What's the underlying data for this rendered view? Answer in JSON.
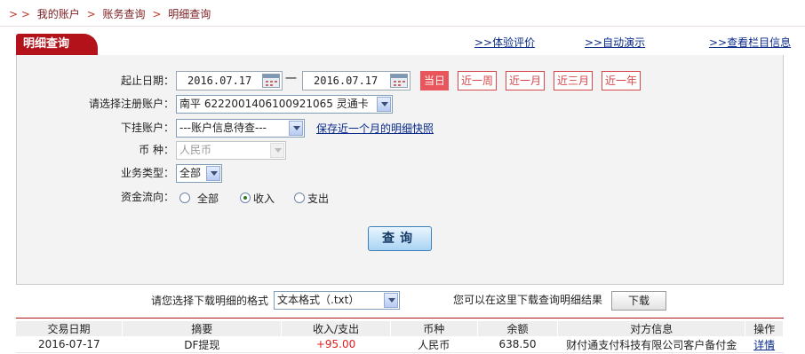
{
  "breadcrumb": {
    "arrows": ">  >",
    "items": [
      "我的账户",
      "账务查询",
      "明细查询"
    ]
  },
  "panel": {
    "title": "明细查询",
    "links": [
      ">>体验评价",
      ">>自动演示",
      ">>查看栏目信息"
    ]
  },
  "form": {
    "date_label": "起止日期：",
    "start_date": "2016.07.17",
    "dash": "一",
    "end_date": "2016.07.17",
    "quick_ranges": [
      "当日",
      "近一周",
      "近一月",
      "近三月",
      "近一年"
    ],
    "account_label": "请选择注册账户：",
    "account_value": "南平  6222001406100921065 灵通卡",
    "sub_label": "下挂账户：",
    "sub_value": "---账户信息待查---",
    "save_link": "保存近一个月的明细快照",
    "currency_label": "币      种：",
    "currency_value": "人民币",
    "biz_label": "业务类型：",
    "biz_value": "全部",
    "flow_label": "资金流向：",
    "flow_options": [
      "全部",
      "收入",
      "支出"
    ],
    "flow_selected": "收入",
    "query_button": "查询"
  },
  "download": {
    "format_label": "请您选择下载明细的格式",
    "format_value": "文本格式（.txt）",
    "hint": "您可以在这里下载查询明细结果",
    "button": "下载"
  },
  "table": {
    "headers": [
      "交易日期",
      "摘要",
      "收入/支出",
      "币种",
      "余额",
      "对方信息",
      "操作"
    ],
    "rows": [
      [
        "2016-07-17",
        "DF提现",
        "+95.00",
        "人民币",
        "638.50",
        "财付通支付科技有限公司客户备付金",
        "详情"
      ]
    ]
  },
  "colors": {
    "brand": "#b3121a",
    "link": "#0b2b8a",
    "income": "#e02020"
  }
}
